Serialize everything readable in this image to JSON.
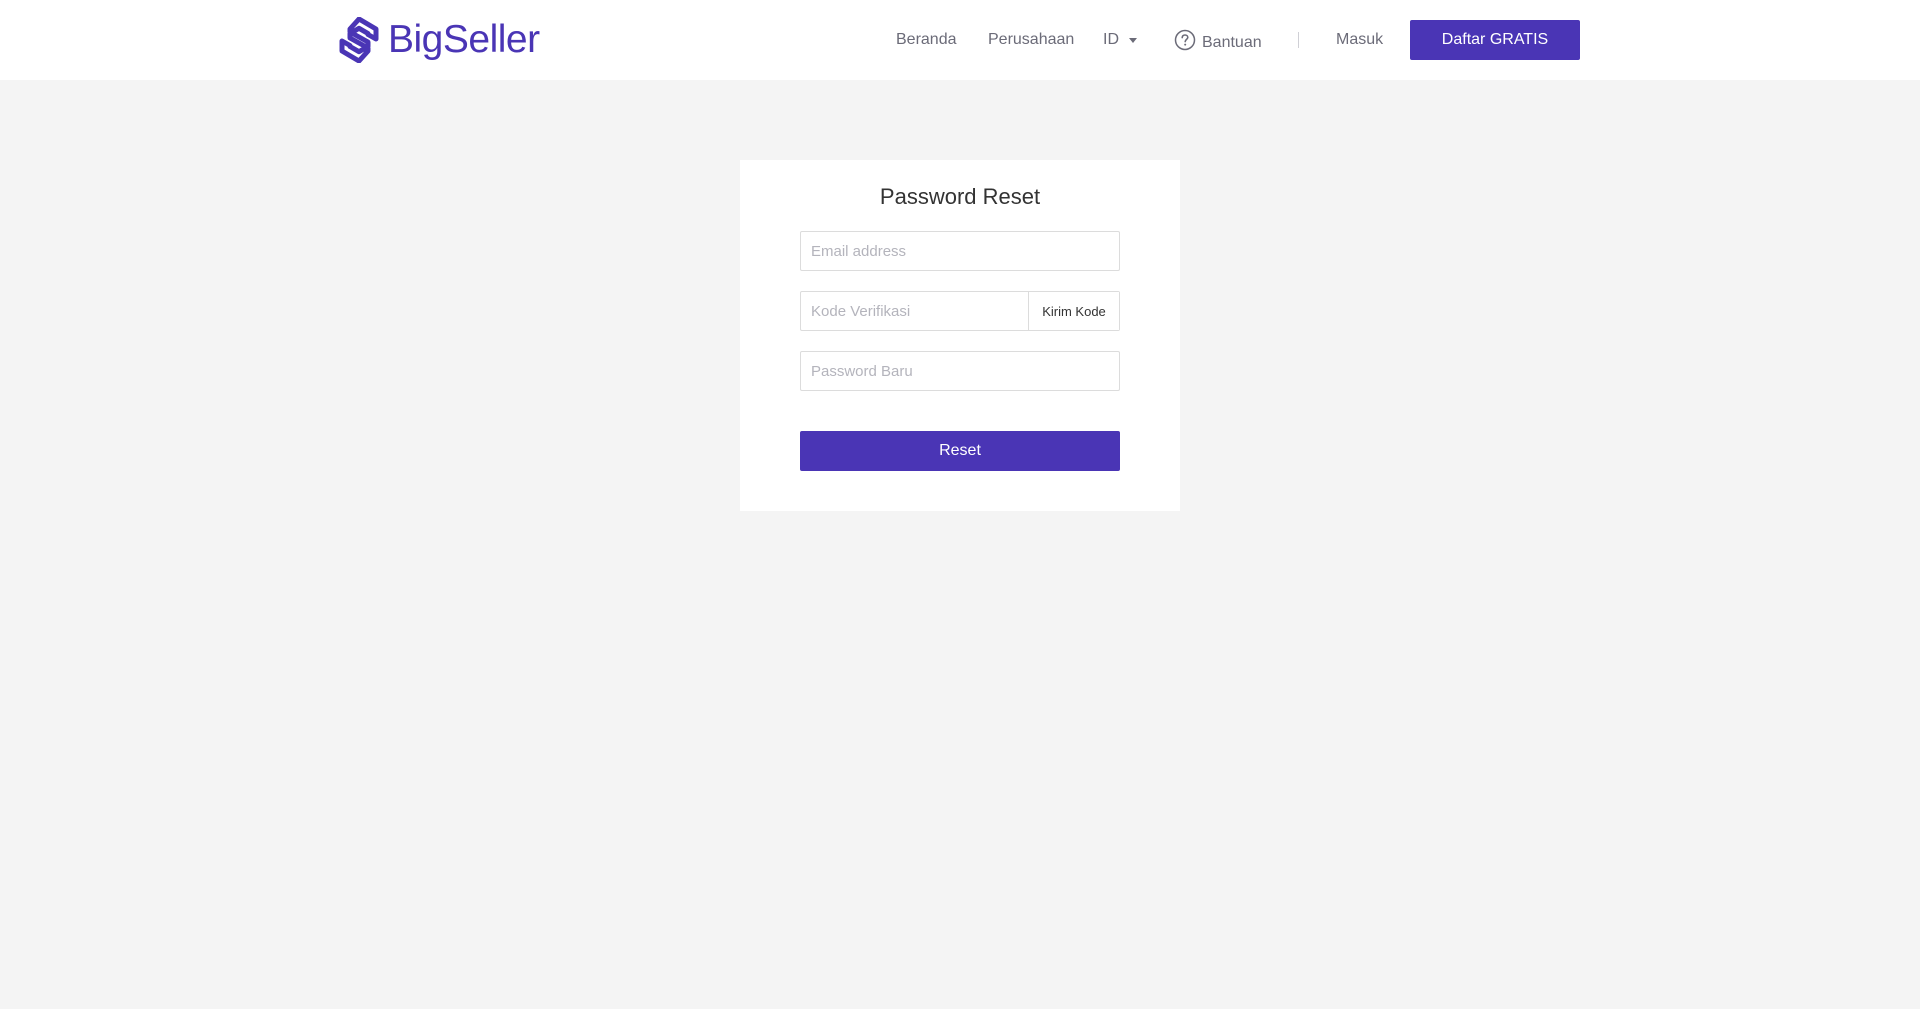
{
  "brand": {
    "name": "BigSeller",
    "accent_color": "#4a35b5"
  },
  "nav": {
    "home": "Beranda",
    "company": "Perusahaan",
    "language": "ID",
    "help": "Bantuan",
    "login": "Masuk",
    "signup": "Daftar GRATIS",
    "icons": {
      "language_caret": "caret-down-icon",
      "help": "question-circle-icon"
    }
  },
  "form": {
    "title": "Password Reset",
    "email_placeholder": "Email address",
    "email_value": "",
    "code_placeholder": "Kode Verifikasi",
    "code_value": "",
    "send_code_label": "Kirim Kode",
    "new_password_placeholder": "Password Baru",
    "new_password_value": "",
    "submit_label": "Reset"
  }
}
